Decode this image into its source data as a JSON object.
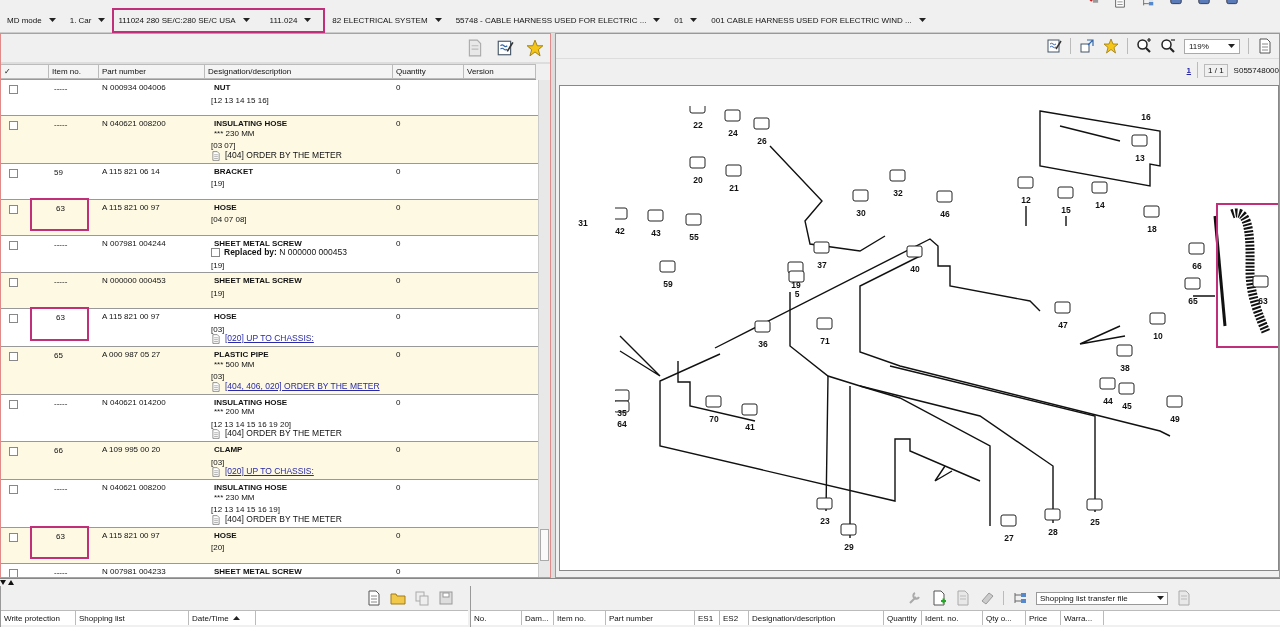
{
  "breadcrumbs": [
    {
      "label": "MD mode",
      "highlighted": false
    },
    {
      "label": "1. Car",
      "highlighted": false
    },
    {
      "label": "111024 280 SE/C:280 SE/C USA",
      "highlighted": true
    },
    {
      "label": "111.024",
      "highlighted": true
    },
    {
      "label": "82 ELECTRICAL SYSTEM",
      "highlighted": false
    },
    {
      "label": "55748 - CABLE HARNESS USED FOR ELECTRIC  ...",
      "highlighted": false
    },
    {
      "label": "01",
      "highlighted": false
    },
    {
      "label": "001 CABLE HARNESS USED FOR ELECTRIC WIND ...",
      "highlighted": false
    }
  ],
  "parts_table": {
    "columns": [
      "✓",
      "Item no.",
      "Part number",
      "Designation/description",
      "Quantity",
      "Version"
    ],
    "rows": [
      {
        "checked": false,
        "item": "-----",
        "highlighted": false,
        "part_number": "N 000934 004006",
        "designation": "NUT",
        "refs": "[12 13 14 15 16]",
        "quantity": "0"
      },
      {
        "checked": false,
        "item": "-----",
        "highlighted": false,
        "part_number": "N 040621 008200",
        "designation": "INSULATING HOSE",
        "size": "*** 230 MM",
        "refs": "[03 07]",
        "footnote": {
          "kind": "note",
          "text": "[404] ORDER BY THE METER"
        },
        "quantity": "0"
      },
      {
        "checked": false,
        "item": "59",
        "highlighted": false,
        "part_number": "A 115 821 06 14",
        "designation": "BRACKET",
        "refs": "[19]",
        "quantity": "0"
      },
      {
        "checked": false,
        "item": "63",
        "highlighted": true,
        "part_number": "A 115 821 00 97",
        "designation": "HOSE",
        "refs": "[04 07 08]",
        "quantity": "0"
      },
      {
        "checked": false,
        "item": "-----",
        "highlighted": false,
        "part_number": "N 007981 004244",
        "designation": "SHEET METAL SCREW",
        "replaced_by": "**Replaced by:** N 000000 000453",
        "refs": "[19]",
        "quantity": "0"
      },
      {
        "checked": false,
        "item": "-----",
        "highlighted": false,
        "part_number": "N 000000 000453",
        "designation": "SHEET METAL SCREW",
        "refs": "[19]",
        "quantity": "0"
      },
      {
        "checked": false,
        "item": "63",
        "highlighted": true,
        "part_number": "A 115 821 00 97",
        "designation": "HOSE",
        "refs": "[03]",
        "footnote": {
          "kind": "link",
          "text": "[020] UP TO CHASSIS:"
        },
        "quantity": "0"
      },
      {
        "checked": false,
        "item": "65",
        "highlighted": false,
        "part_number": "A 000 987 05 27",
        "designation": "PLASTIC PIPE",
        "size": "*** 500 MM",
        "refs": "[03]",
        "footnote": {
          "kind": "link",
          "text": "[404, 406, 020] ORDER BY THE METER"
        },
        "quantity": "0"
      },
      {
        "checked": false,
        "item": "-----",
        "highlighted": false,
        "part_number": "N 040621 014200",
        "designation": "INSULATING HOSE",
        "size": "*** 200 MM",
        "refs": "[12 13 14 15 16 19 20]",
        "footnote": {
          "kind": "note",
          "text": "[404] ORDER BY THE METER"
        },
        "quantity": "0"
      },
      {
        "checked": false,
        "item": "66",
        "highlighted": false,
        "part_number": "A 109 995 00 20",
        "designation": "CLAMP",
        "refs": "[03]",
        "footnote": {
          "kind": "link",
          "text": "[020] UP TO CHASSIS:"
        },
        "quantity": "0"
      },
      {
        "checked": false,
        "item": "-----",
        "highlighted": false,
        "part_number": "N 040621 008200",
        "designation": "INSULATING HOSE",
        "size": "*** 230 MM",
        "refs": "[12 13 14 15 16 19]",
        "footnote": {
          "kind": "note",
          "text": "[404] ORDER BY THE METER"
        },
        "quantity": "0"
      },
      {
        "checked": false,
        "item": "63",
        "highlighted": true,
        "part_number": "A 115 821 00 97",
        "designation": "HOSE",
        "refs": "[20]",
        "quantity": "0"
      },
      {
        "checked": false,
        "item": "-----",
        "highlighted": false,
        "part_number": "N 007981 004233",
        "designation": "SHEET METAL SCREW",
        "quantity": "0"
      }
    ]
  },
  "diagram_panel": {
    "zoom": "119%",
    "page_link": "1",
    "page_count": "1 / 1",
    "sheet": "S055748000",
    "callouts": [
      {
        "label": "22",
        "highlighted": false
      },
      {
        "label": "24",
        "highlighted": false
      },
      {
        "label": "26",
        "highlighted": false
      },
      {
        "label": "20",
        "highlighted": false
      },
      {
        "label": "21",
        "highlighted": false
      },
      {
        "label": "16",
        "highlighted": false
      },
      {
        "label": "13",
        "highlighted": false
      },
      {
        "label": "12",
        "highlighted": false
      },
      {
        "label": "15",
        "highlighted": false
      },
      {
        "label": "14",
        "highlighted": false
      },
      {
        "label": "18",
        "highlighted": false
      },
      {
        "label": "31",
        "highlighted": false
      },
      {
        "label": "42",
        "highlighted": false
      },
      {
        "label": "43",
        "highlighted": false
      },
      {
        "label": "55",
        "highlighted": false
      },
      {
        "label": "30",
        "highlighted": false
      },
      {
        "label": "32",
        "highlighted": false
      },
      {
        "label": "46",
        "highlighted": false
      },
      {
        "label": "66",
        "highlighted": false
      },
      {
        "label": "65",
        "highlighted": false
      },
      {
        "label": "63",
        "highlighted": true
      },
      {
        "label": "59",
        "highlighted": false
      },
      {
        "label": "37",
        "highlighted": false
      },
      {
        "label": "40",
        "highlighted": false
      },
      {
        "label": "19",
        "highlighted": false
      },
      {
        "label": "5",
        "highlighted": false
      },
      {
        "label": "47",
        "highlighted": false
      },
      {
        "label": "10",
        "highlighted": false
      },
      {
        "label": "36",
        "highlighted": false
      },
      {
        "label": "71",
        "highlighted": false
      },
      {
        "label": "38",
        "highlighted": false
      },
      {
        "label": "44",
        "highlighted": false
      },
      {
        "label": "45",
        "highlighted": false
      },
      {
        "label": "49",
        "highlighted": false
      },
      {
        "label": "35",
        "highlighted": false
      },
      {
        "label": "64",
        "highlighted": false
      },
      {
        "label": "70",
        "highlighted": false
      },
      {
        "label": "41",
        "highlighted": false
      },
      {
        "label": "23",
        "highlighted": false
      },
      {
        "label": "29",
        "highlighted": false
      },
      {
        "label": "27",
        "highlighted": false
      },
      {
        "label": "28",
        "highlighted": false
      },
      {
        "label": "25",
        "highlighted": false
      }
    ]
  },
  "shopping_lists": {
    "columns": [
      {
        "label": "Write protection",
        "sorted": false
      },
      {
        "label": "Shopping list",
        "sorted": false
      },
      {
        "label": "Date/Time",
        "sorted": true
      }
    ]
  },
  "cart": {
    "transfer_select": "Shopping list transfer file",
    "columns": [
      "No.",
      "Dam...",
      "Item no.",
      "Part number",
      "ES1",
      "ES2",
      "Designation/description",
      "Quantity",
      "Ident. no.",
      "Qty o...",
      "Price",
      "Warra..."
    ]
  }
}
